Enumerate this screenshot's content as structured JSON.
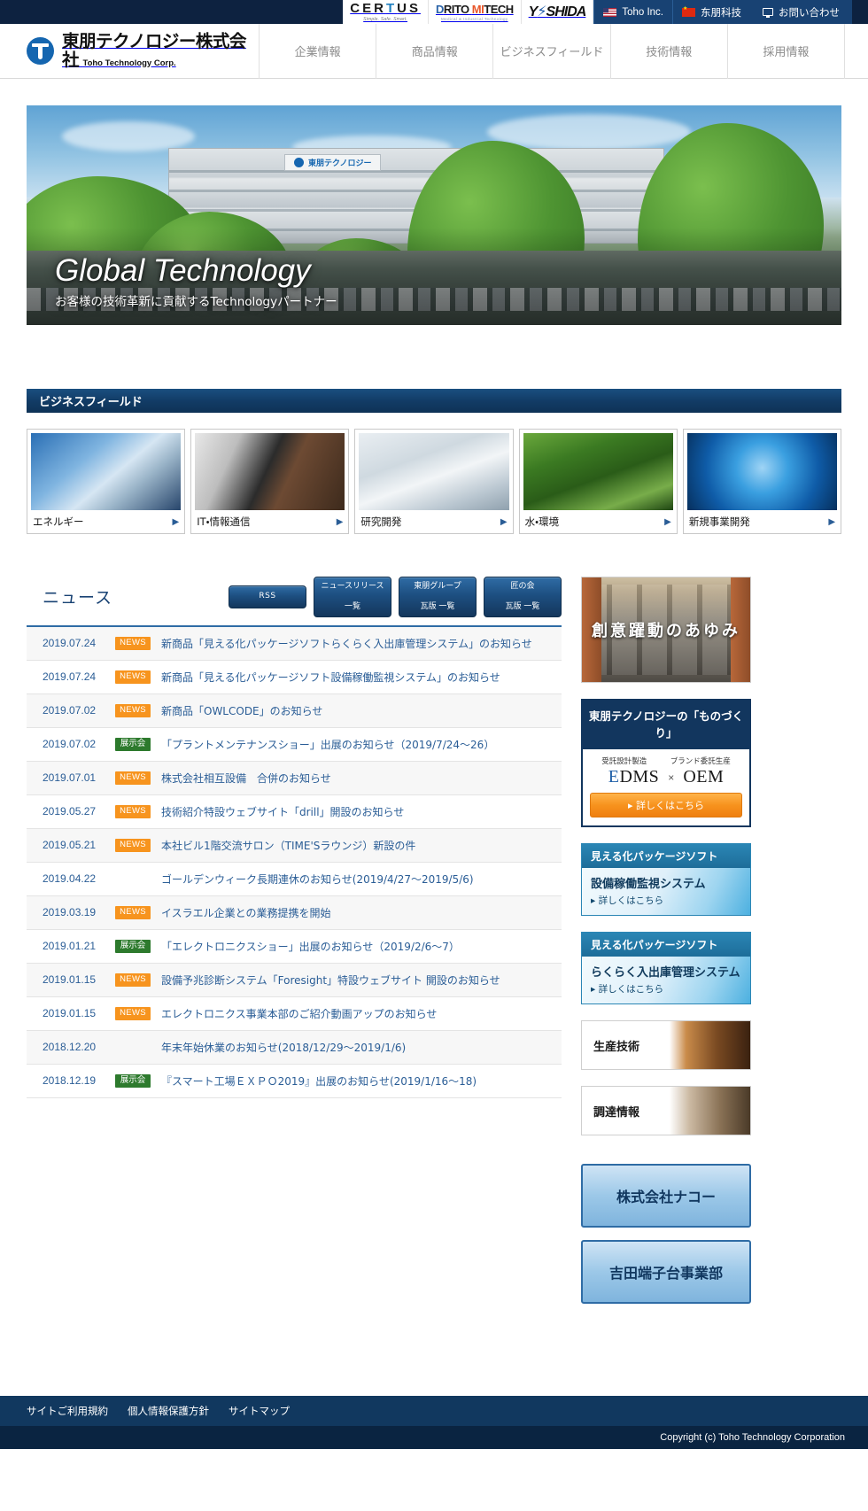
{
  "topbar": {
    "logos": [
      {
        "name": "certus",
        "main": "CERTUS",
        "sub": "Simple. Safe. Smart."
      },
      {
        "name": "drito-mitech",
        "main": "DRITO MITECH",
        "sub": "Medical & Industrial Technology"
      },
      {
        "name": "yoshida",
        "main": "YOSHIDA"
      }
    ],
    "links": [
      {
        "name": "toho-inc",
        "label": "Toho Inc.",
        "flag": "us"
      },
      {
        "name": "toho-china",
        "label": "东朋科技",
        "flag": "cn"
      }
    ],
    "contact_label": "お問い合わせ",
    "contact_icon": "monitor-icon"
  },
  "header": {
    "brand_jp": "東朋テクノロジー株式会社",
    "brand_en": "Toho Technology Corp.",
    "brand_icon": "toho-logo-mark",
    "nav": [
      {
        "name": "corporate",
        "label": "企業情報"
      },
      {
        "name": "products",
        "label": "商品情報"
      },
      {
        "name": "business-field",
        "label": "ビジネスフィールド"
      },
      {
        "name": "technology",
        "label": "技術情報"
      },
      {
        "name": "recruit",
        "label": "採用情報"
      }
    ]
  },
  "hero": {
    "title": "Global Technology",
    "subtitle": "お客様の技術革新に貢献するTechnologyパートナー",
    "building_sign": "東朋テクノロジー"
  },
  "business_field": {
    "section_title": "ビジネスフィールド",
    "cards": [
      {
        "name": "energy",
        "label": "エネルギー",
        "img": "fi-energy"
      },
      {
        "name": "it-telecom",
        "label": "IT・情報通信",
        "img": "fi-it"
      },
      {
        "name": "research",
        "label": "研究開発",
        "img": "fi-rd"
      },
      {
        "name": "water-environment",
        "label": "水・環境",
        "img": "fi-water"
      },
      {
        "name": "new-business",
        "label": "新規事業開発",
        "img": "fi-new"
      }
    ]
  },
  "news": {
    "title": "ニュース",
    "buttons": [
      {
        "name": "rss",
        "line1": "RSS",
        "line2": ""
      },
      {
        "name": "news-release-list",
        "line1": "ニュースリリース",
        "line2": "一覧"
      },
      {
        "name": "toho-group-kawaraban",
        "line1": "東朋グループ",
        "line2": "瓦版 一覧"
      },
      {
        "name": "takumi-no-kai-kawaraban",
        "line1": "匠の会",
        "line2": "瓦版 一覧"
      }
    ],
    "items": [
      {
        "date": "2019.07.24",
        "badge": "NEWS",
        "badge_type": "news",
        "text": "新商品「見える化パッケージソフトらくらく入出庫管理システム」のお知らせ"
      },
      {
        "date": "2019.07.24",
        "badge": "NEWS",
        "badge_type": "news",
        "text": "新商品「見える化パッケージソフト設備稼働監視システム」のお知らせ"
      },
      {
        "date": "2019.07.02",
        "badge": "NEWS",
        "badge_type": "news",
        "text": "新商品「OWLCODE」のお知らせ"
      },
      {
        "date": "2019.07.02",
        "badge": "展示会",
        "badge_type": "expo",
        "text": "「プラントメンテナンスショー」出展のお知らせ（2019/7/24〜26）"
      },
      {
        "date": "2019.07.01",
        "badge": "NEWS",
        "badge_type": "news",
        "text": "株式会社相互設備　合併のお知らせ"
      },
      {
        "date": "2019.05.27",
        "badge": "NEWS",
        "badge_type": "news",
        "text": "技術紹介特設ウェブサイト「drill」開設のお知らせ"
      },
      {
        "date": "2019.05.21",
        "badge": "NEWS",
        "badge_type": "news",
        "text": "本社ビル1階交流サロン（TIME'Sラウンジ）新設の件"
      },
      {
        "date": "2019.04.22",
        "badge": "",
        "badge_type": "none",
        "text": "ゴールデンウィーク長期連休のお知らせ(2019/4/27〜2019/5/6)"
      },
      {
        "date": "2019.03.19",
        "badge": "NEWS",
        "badge_type": "news",
        "text": "イスラエル企業との業務提携を開始"
      },
      {
        "date": "2019.01.21",
        "badge": "展示会",
        "badge_type": "expo",
        "text": "「エレクトロニクスショー」出展のお知らせ（2019/2/6〜7）"
      },
      {
        "date": "2019.01.15",
        "badge": "NEWS",
        "badge_type": "news",
        "text": "設備予兆診断システム「Foresight」特設ウェブサイト 開設のお知らせ"
      },
      {
        "date": "2019.01.15",
        "badge": "NEWS",
        "badge_type": "news",
        "text": "エレクトロニクス事業本部のご紹介動画アップのお知らせ"
      },
      {
        "date": "2018.12.20",
        "badge": "",
        "badge_type": "none",
        "text": "年末年始休業のお知らせ(2018/12/29〜2019/1/6)"
      },
      {
        "date": "2018.12.19",
        "badge": "展示会",
        "badge_type": "expo",
        "text": "『スマート工場ＥＸＰＯ2019』出展のお知らせ(2019/1/16〜18)"
      }
    ]
  },
  "sidebar": {
    "ayumi": {
      "name": "souiyakudou-no-ayumi",
      "text": "創意躍動のあゆみ"
    },
    "monozukuri": {
      "head": "東朋テクノロジーの「ものづくり」",
      "label_left": "受託設計製造",
      "label_right": "ブランド委託生産",
      "term_left": "EDMS",
      "term_mid": "×",
      "term_right": "OEM",
      "cta": "詳しくはこちら"
    },
    "mieruka": [
      {
        "name": "equipment-monitoring",
        "head": "見える化パッケージソフト",
        "product": "設備稼働監視システム",
        "more": "詳しくはこちら"
      },
      {
        "name": "warehouse-management",
        "head": "見える化パッケージソフト",
        "product": "らくらく入出庫管理システム",
        "more": "詳しくはこちら"
      }
    ],
    "plain": [
      {
        "name": "production-technology",
        "label": "生産技術",
        "style": "pb-seisan"
      },
      {
        "name": "procurement-info",
        "label": "調達情報",
        "style": "pb-chotatsu"
      }
    ],
    "groups": [
      {
        "name": "naco-corp",
        "label": "株式会社ナコー"
      },
      {
        "name": "yoshida-terminal",
        "label": "吉田端子台事業部"
      }
    ]
  },
  "footer": {
    "links": [
      {
        "name": "terms-of-use",
        "label": "サイトご利用規約"
      },
      {
        "name": "privacy-policy",
        "label": "個人情報保護方針"
      },
      {
        "name": "sitemap",
        "label": "サイトマップ"
      }
    ],
    "copyright": "Copyright (c) Toho Technology Corporation"
  }
}
